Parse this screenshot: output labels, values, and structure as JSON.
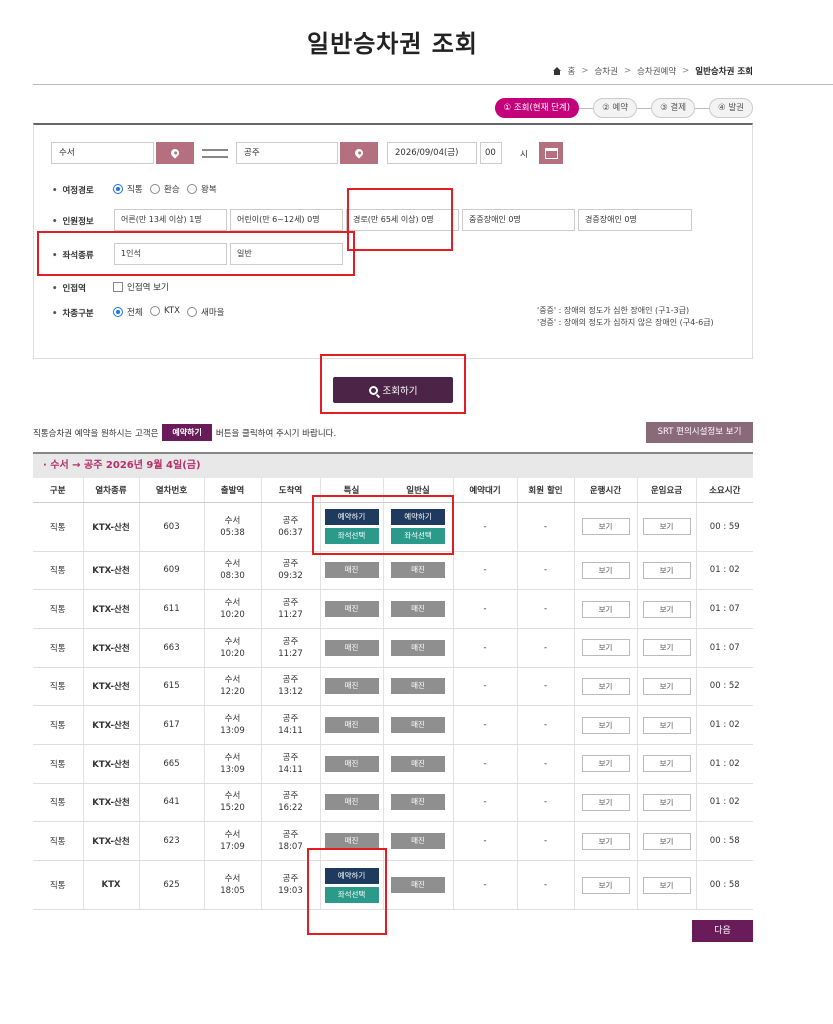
{
  "title": "일반승차권 조회",
  "breadcrumb": [
    "홈",
    "승차권",
    "승차권예약",
    "일반승차권 조회"
  ],
  "steps": [
    "① 조회(현재 단계)",
    "② 예약",
    "③ 결제",
    "④ 발권"
  ],
  "search": {
    "departure": "수서",
    "arrival": "공주",
    "date": "2026/09/04(금)",
    "hour": "00",
    "hour_unit": "시",
    "route_label": "여정경로",
    "route_options": [
      "직통",
      "환승",
      "왕복"
    ],
    "route_selected": "직통",
    "pax_label": "인원정보",
    "pax": [
      "어른(만 13세 이상) 1명",
      "어린이(만 6~12세) 0명",
      "경로(만 65세 이상) 0명",
      "중증장애인 0명",
      "경증장애인 0명"
    ],
    "seat_label": "좌석종류",
    "seat_count": "1인석",
    "seat_type": "일반",
    "adjacent_label": "인접역",
    "adjacent_option": "인접역 보기",
    "train_label": "차종구분",
    "train_options": [
      "전체",
      "KTX",
      "새마을"
    ],
    "train_selected": "전체",
    "note1": "'중증' : 장애의 정도가 심한 장애인 (구1-3급)",
    "note2": "'경증' : 장애의 정도가 심하지 않은 장애인 (구4-6급)",
    "search_button": "조회하기"
  },
  "info": {
    "prefix": "직통승차권 예약을 원하시는 고객은",
    "button": "예약하기",
    "suffix": "버튼을 클릭하여 주시기 바랍니다.",
    "srt_button": "SRT 편의시설정보 보기"
  },
  "route_header": "· 수서 → 공주   2026년 9월 4일(금)",
  "table": {
    "headers": [
      "구분",
      "열차종류",
      "열차번호",
      "출발역",
      "도착역",
      "특실",
      "일반실",
      "예약대기",
      "회원 할인",
      "운행시간",
      "운임요금",
      "소요시간"
    ],
    "labels": {
      "reserve": "예약하기",
      "seat": "좌석선택",
      "sold": "매진",
      "view": "보기",
      "dash": "-"
    },
    "rows": [
      {
        "type": "직통",
        "train": "KTX-산천",
        "no": "603",
        "dep": "수서",
        "dep_t": "05:38",
        "arr": "공주",
        "arr_t": "06:37",
        "first": "avail",
        "general": "avail",
        "dur": "00 : 59"
      },
      {
        "type": "직통",
        "train": "KTX-산천",
        "no": "609",
        "dep": "수서",
        "dep_t": "08:30",
        "arr": "공주",
        "arr_t": "09:32",
        "first": "sold",
        "general": "sold",
        "dur": "01 : 02"
      },
      {
        "type": "직통",
        "train": "KTX-산천",
        "no": "611",
        "dep": "수서",
        "dep_t": "10:20",
        "arr": "공주",
        "arr_t": "11:27",
        "first": "sold",
        "general": "sold",
        "dur": "01 : 07"
      },
      {
        "type": "직통",
        "train": "KTX-산천",
        "no": "663",
        "dep": "수서",
        "dep_t": "10:20",
        "arr": "공주",
        "arr_t": "11:27",
        "first": "sold",
        "general": "sold",
        "dur": "01 : 07"
      },
      {
        "type": "직통",
        "train": "KTX-산천",
        "no": "615",
        "dep": "수서",
        "dep_t": "12:20",
        "arr": "공주",
        "arr_t": "13:12",
        "first": "sold",
        "general": "sold",
        "dur": "00 : 52"
      },
      {
        "type": "직통",
        "train": "KTX-산천",
        "no": "617",
        "dep": "수서",
        "dep_t": "13:09",
        "arr": "공주",
        "arr_t": "14:11",
        "first": "sold",
        "general": "sold",
        "dur": "01 : 02"
      },
      {
        "type": "직통",
        "train": "KTX-산천",
        "no": "665",
        "dep": "수서",
        "dep_t": "13:09",
        "arr": "공주",
        "arr_t": "14:11",
        "first": "sold",
        "general": "sold",
        "dur": "01 : 02"
      },
      {
        "type": "직통",
        "train": "KTX-산천",
        "no": "641",
        "dep": "수서",
        "dep_t": "15:20",
        "arr": "공주",
        "arr_t": "16:22",
        "first": "sold",
        "general": "sold",
        "dur": "01 : 02"
      },
      {
        "type": "직통",
        "train": "KTX-산천",
        "no": "623",
        "dep": "수서",
        "dep_t": "17:09",
        "arr": "공주",
        "arr_t": "18:07",
        "first": "sold",
        "general": "sold",
        "dur": "00 : 58"
      },
      {
        "type": "직통",
        "train": "KTX",
        "no": "625",
        "dep": "수서",
        "dep_t": "18:05",
        "arr": "공주",
        "arr_t": "19:03",
        "first": "avail",
        "general": "sold",
        "dur": "00 : 58"
      }
    ]
  },
  "next_button": "다음",
  "colors": {
    "accent": "#c4007a",
    "primary": "#4b2447",
    "highlight": "#e51c23"
  }
}
